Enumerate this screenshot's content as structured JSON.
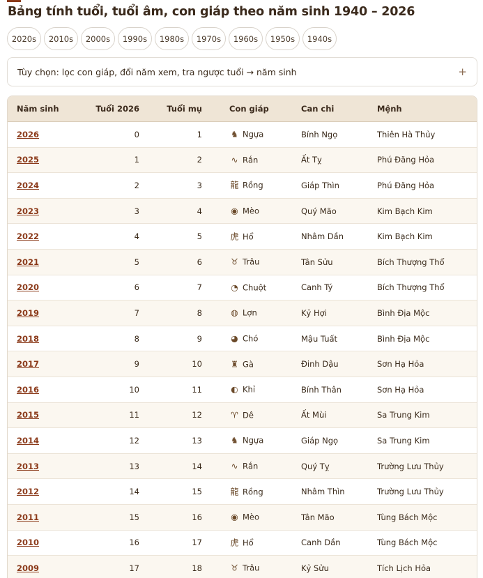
{
  "page_title": "Bảng tính tuổi, tuổi âm, con giáp theo năm sinh 1940 – 2026",
  "decades": [
    "2020s",
    "2010s",
    "2000s",
    "1990s",
    "1980s",
    "1970s",
    "1960s",
    "1950s",
    "1940s"
  ],
  "options": {
    "label": "Tùy chọn: lọc con giáp, đổi năm xem, tra ngược tuổi → năm sinh",
    "toggle": "+"
  },
  "table": {
    "headers": {
      "year": "Năm sinh",
      "age": "Tuổi 2026",
      "lunar": "Tuổi mụ",
      "zodiac": "Con giáp",
      "canchi": "Can chi",
      "menh": "Mệnh"
    },
    "rows": [
      {
        "year": "2026",
        "age": "0",
        "lunar": "1",
        "zodiac": "Ngựa",
        "icon": "horse-icon",
        "canchi": "Bính Ngọ",
        "menh": "Thiên Hà Thủy"
      },
      {
        "year": "2025",
        "age": "1",
        "lunar": "2",
        "zodiac": "Rắn",
        "icon": "snake-icon",
        "canchi": "Ất Tỵ",
        "menh": "Phú Đăng Hỏa"
      },
      {
        "year": "2024",
        "age": "2",
        "lunar": "3",
        "zodiac": "Rồng",
        "icon": "dragon-icon",
        "canchi": "Giáp Thìn",
        "menh": "Phú Đăng Hỏa"
      },
      {
        "year": "2023",
        "age": "3",
        "lunar": "4",
        "zodiac": "Mèo",
        "icon": "cat-icon",
        "canchi": "Quý Mão",
        "menh": "Kim Bạch Kim"
      },
      {
        "year": "2022",
        "age": "4",
        "lunar": "5",
        "zodiac": "Hổ",
        "icon": "tiger-icon",
        "canchi": "Nhâm Dần",
        "menh": "Kim Bạch Kim"
      },
      {
        "year": "2021",
        "age": "5",
        "lunar": "6",
        "zodiac": "Trâu",
        "icon": "buffalo-icon",
        "canchi": "Tân Sửu",
        "menh": "Bích Thượng Thổ"
      },
      {
        "year": "2020",
        "age": "6",
        "lunar": "7",
        "zodiac": "Chuột",
        "icon": "rat-icon",
        "canchi": "Canh Tý",
        "menh": "Bích Thượng Thổ"
      },
      {
        "year": "2019",
        "age": "7",
        "lunar": "8",
        "zodiac": "Lợn",
        "icon": "pig-icon",
        "canchi": "Kỷ Hợi",
        "menh": "Bình Địa Mộc"
      },
      {
        "year": "2018",
        "age": "8",
        "lunar": "9",
        "zodiac": "Chó",
        "icon": "dog-icon",
        "canchi": "Mậu Tuất",
        "menh": "Bình Địa Mộc"
      },
      {
        "year": "2017",
        "age": "9",
        "lunar": "10",
        "zodiac": "Gà",
        "icon": "rooster-icon",
        "canchi": "Đinh Dậu",
        "menh": "Sơn Hạ Hỏa"
      },
      {
        "year": "2016",
        "age": "10",
        "lunar": "11",
        "zodiac": "Khỉ",
        "icon": "monkey-icon",
        "canchi": "Bính Thân",
        "menh": "Sơn Hạ Hỏa"
      },
      {
        "year": "2015",
        "age": "11",
        "lunar": "12",
        "zodiac": "Dê",
        "icon": "goat-icon",
        "canchi": "Ất Mùi",
        "menh": "Sa Trung Kim"
      },
      {
        "year": "2014",
        "age": "12",
        "lunar": "13",
        "zodiac": "Ngựa",
        "icon": "horse-icon",
        "canchi": "Giáp Ngọ",
        "menh": "Sa Trung Kim"
      },
      {
        "year": "2013",
        "age": "13",
        "lunar": "14",
        "zodiac": "Rắn",
        "icon": "snake-icon",
        "canchi": "Quý Tỵ",
        "menh": "Trường Lưu Thủy"
      },
      {
        "year": "2012",
        "age": "14",
        "lunar": "15",
        "zodiac": "Rồng",
        "icon": "dragon-icon",
        "canchi": "Nhâm Thìn",
        "menh": "Trường Lưu Thủy"
      },
      {
        "year": "2011",
        "age": "15",
        "lunar": "16",
        "zodiac": "Mèo",
        "icon": "cat-icon",
        "canchi": "Tân Mão",
        "menh": "Tùng Bách Mộc"
      },
      {
        "year": "2010",
        "age": "16",
        "lunar": "17",
        "zodiac": "Hổ",
        "icon": "tiger-icon",
        "canchi": "Canh Dần",
        "menh": "Tùng Bách Mộc"
      },
      {
        "year": "2009",
        "age": "17",
        "lunar": "18",
        "zodiac": "Trâu",
        "icon": "buffalo-icon",
        "canchi": "Kỷ Sửu",
        "menh": "Tích Lịch Hỏa"
      }
    ]
  },
  "colors": {
    "accent": "#8b3a1a",
    "header_bg": "#efe5d6",
    "row_alt": "#fbf7f0"
  }
}
